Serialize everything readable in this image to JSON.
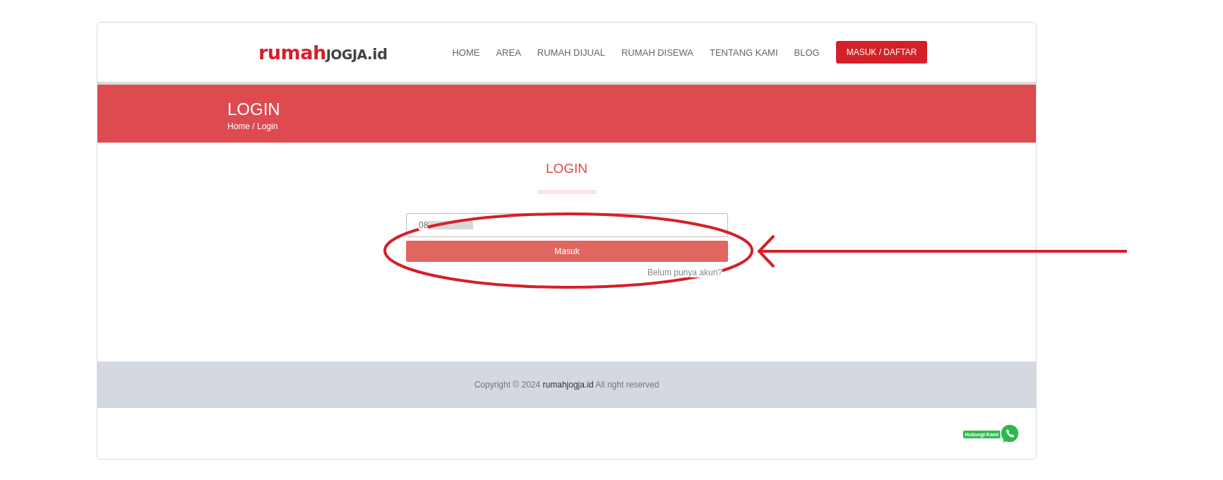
{
  "header": {
    "logo": {
      "part_1": "rumah",
      "part_2": "JOGJA",
      "part_3": ".id"
    },
    "nav": [
      {
        "label": "HOME"
      },
      {
        "label": "AREA"
      },
      {
        "label": "RUMAH DIJUAL"
      },
      {
        "label": "RUMAH DISEWA"
      },
      {
        "label": "TENTANG KAMI"
      },
      {
        "label": "BLOG"
      }
    ],
    "cta_button": "MASUK / DAFTAR"
  },
  "banner": {
    "title": "LOGIN",
    "breadcrumb": "Home / Login"
  },
  "login_form": {
    "heading": "LOGIN",
    "phone_field": {
      "value": "08",
      "redacted": true
    },
    "submit_button": "Masuk",
    "register_link": "Belum punya akun?"
  },
  "footer": {
    "copyright": "Copyright © 2024 **rumahjogja.id** All right reserved"
  },
  "chat_widget": {
    "label": "Hubungi Kami"
  },
  "annotation": {
    "highlight": true,
    "arrow": true
  }
}
